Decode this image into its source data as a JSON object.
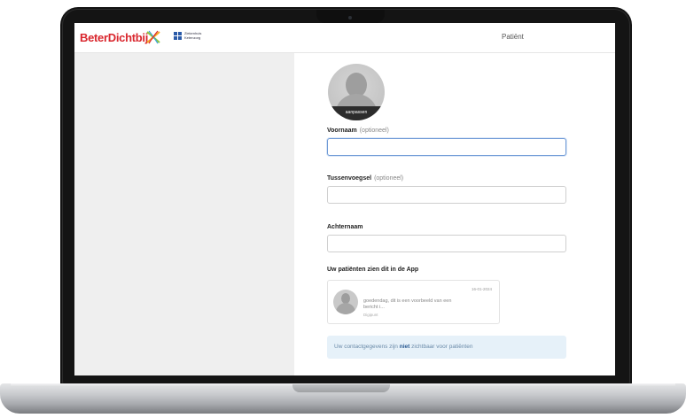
{
  "header": {
    "brand_name": "BeterDichtbij",
    "partner_logo_text": "Ziekenhuis Ketenzorg",
    "role_label": "Patiënt"
  },
  "profile": {
    "avatar_action_label": "aanpassen"
  },
  "form": {
    "first_name": {
      "label": "Voornaam",
      "optional_note": "(optioneel)",
      "value": ""
    },
    "middle_name": {
      "label": "Tussenvoegsel",
      "optional_note": "(optioneel)",
      "value": ""
    },
    "last_name": {
      "label": "Achternaam",
      "value": ""
    }
  },
  "preview": {
    "title": "Uw patiënten zien dit in de App",
    "date": "16-01-2024",
    "message": "goedendag, dit is een voorbeeld van een bericht i...",
    "sender": "Digipunt"
  },
  "info": {
    "text_before": "Uw contactgegevens zijn ",
    "text_strong": "niet",
    "text_after": " zichtbaar voor patiënten"
  },
  "colors": {
    "brand_red": "#d9262d",
    "focus_border": "#6f9ad6",
    "info_background": "#e6f1f9",
    "info_strong": "#2a5a92"
  },
  "icons": {
    "brand_icon": "cross-x-icon",
    "partner_icon": "partner-logo-icon",
    "avatar_icon": "user-silhouette-icon"
  }
}
